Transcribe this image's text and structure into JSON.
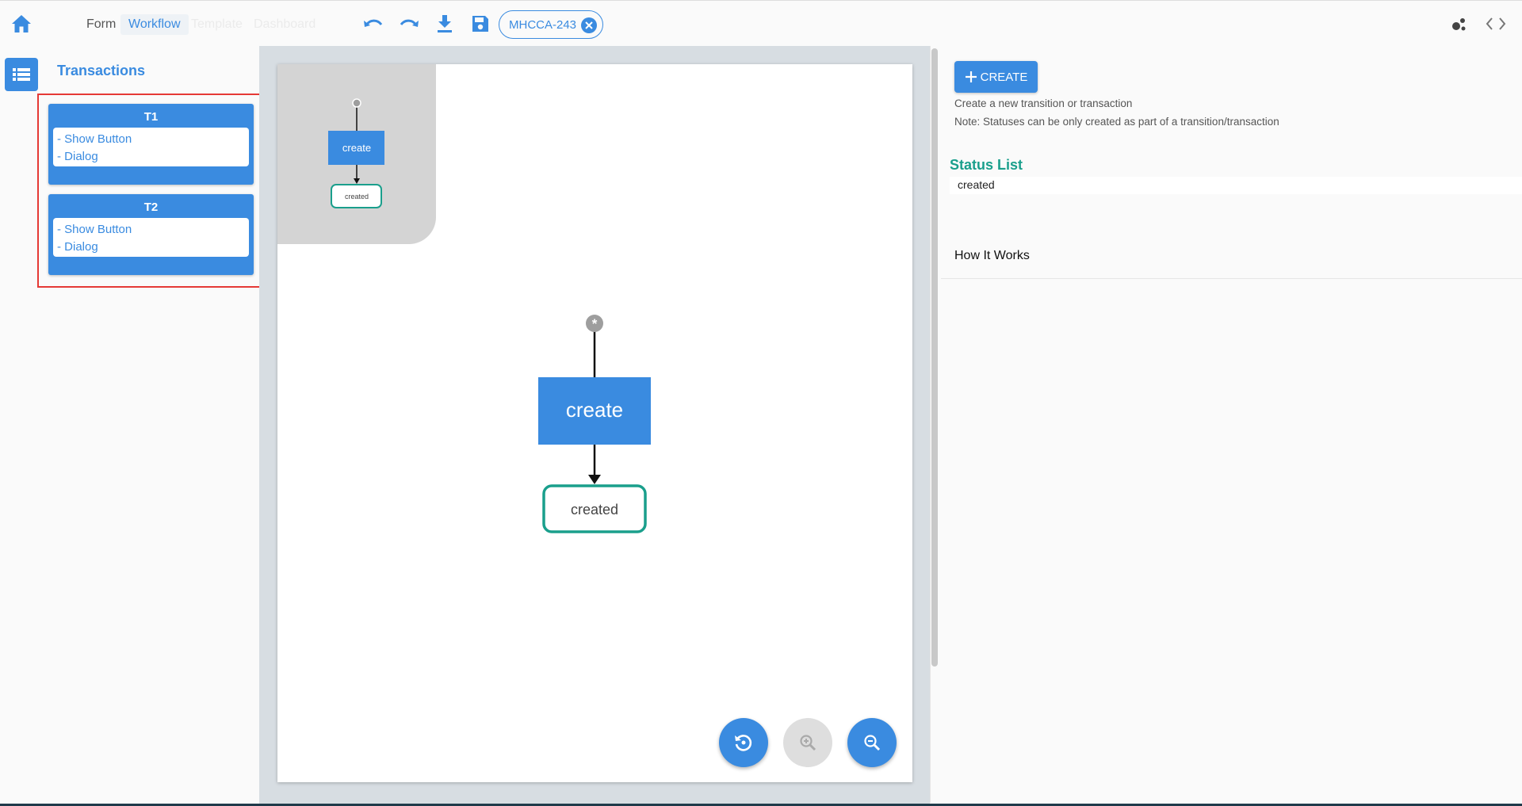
{
  "header": {
    "nav": [
      {
        "label": "Form",
        "state": "normal"
      },
      {
        "label": "Workflow",
        "state": "active"
      },
      {
        "label": "Template",
        "state": "disabled"
      },
      {
        "label": "Dashboard",
        "state": "disabled"
      }
    ],
    "chip_label": "MHCCA-243",
    "icons": [
      "home-icon",
      "undo-icon",
      "redo-icon",
      "download-icon",
      "save-icon",
      "close-icon",
      "bubbles-icon",
      "code-icon"
    ],
    "accent": "#3a8be0"
  },
  "left_panel": {
    "title": "Transactions",
    "transactions": [
      {
        "name": "T1",
        "items": [
          "- Show Button",
          "- Dialog"
        ]
      },
      {
        "name": "T2",
        "items": [
          "- Show Button",
          "- Dialog"
        ]
      }
    ]
  },
  "canvas": {
    "transition_label": "create",
    "status_label": "created",
    "start_marker": "*",
    "status_color": "#1a9f8c"
  },
  "right_panel": {
    "create_label": "CREATE",
    "hint1": "Create a new transition or transaction",
    "hint2": "Note: Statuses can be only created as part of a transition/transaction",
    "status_list_title": "Status List",
    "statuses": [
      "created"
    ],
    "how_it_works": "How It Works"
  }
}
